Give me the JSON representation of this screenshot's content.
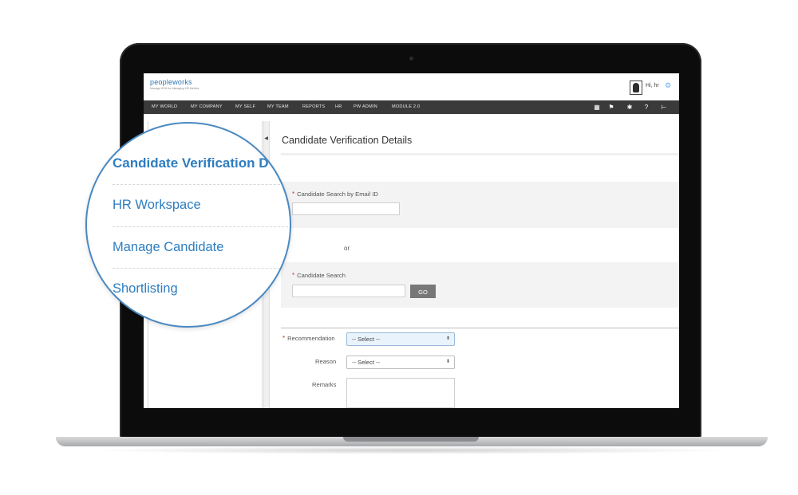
{
  "app": {
    "logo_text": "peopleworks",
    "logo_tagline": "Manage HCM for Managing HR Metrics",
    "greeting": "Hi, hr"
  },
  "nav": {
    "items": [
      "MY WORLD",
      "MY COMPANY",
      "MY SELF",
      "MY TEAM",
      "REPORTS",
      "HR",
      "PW ADMIN",
      "MODULE 2.0"
    ],
    "icons": [
      "book-icon",
      "flag-icon",
      "asterisk-icon",
      "help-icon",
      "sitemap-icon"
    ]
  },
  "page": {
    "title": "Candidate Verification Details",
    "email_search_label": "Candidate Search by Email ID",
    "email_search_value": "",
    "or_text": "or",
    "candidate_search_label": "Candidate Search",
    "candidate_search_value": "",
    "go_label": "GO",
    "recommendation_label": "Recommendation",
    "recommendation_value": "-- Select --",
    "reason_label": "Reason",
    "reason_value": "-- Select --",
    "remarks_label": "Remarks",
    "required_mark": "*"
  },
  "magnifier": {
    "items": [
      "Candidate Verification D",
      "HR Workspace",
      "Manage Candidate",
      "Shortlisting"
    ]
  },
  "colors": {
    "accent": "#2e7dc0",
    "navbar": "#3a3a3a",
    "required": "#c0392b"
  }
}
